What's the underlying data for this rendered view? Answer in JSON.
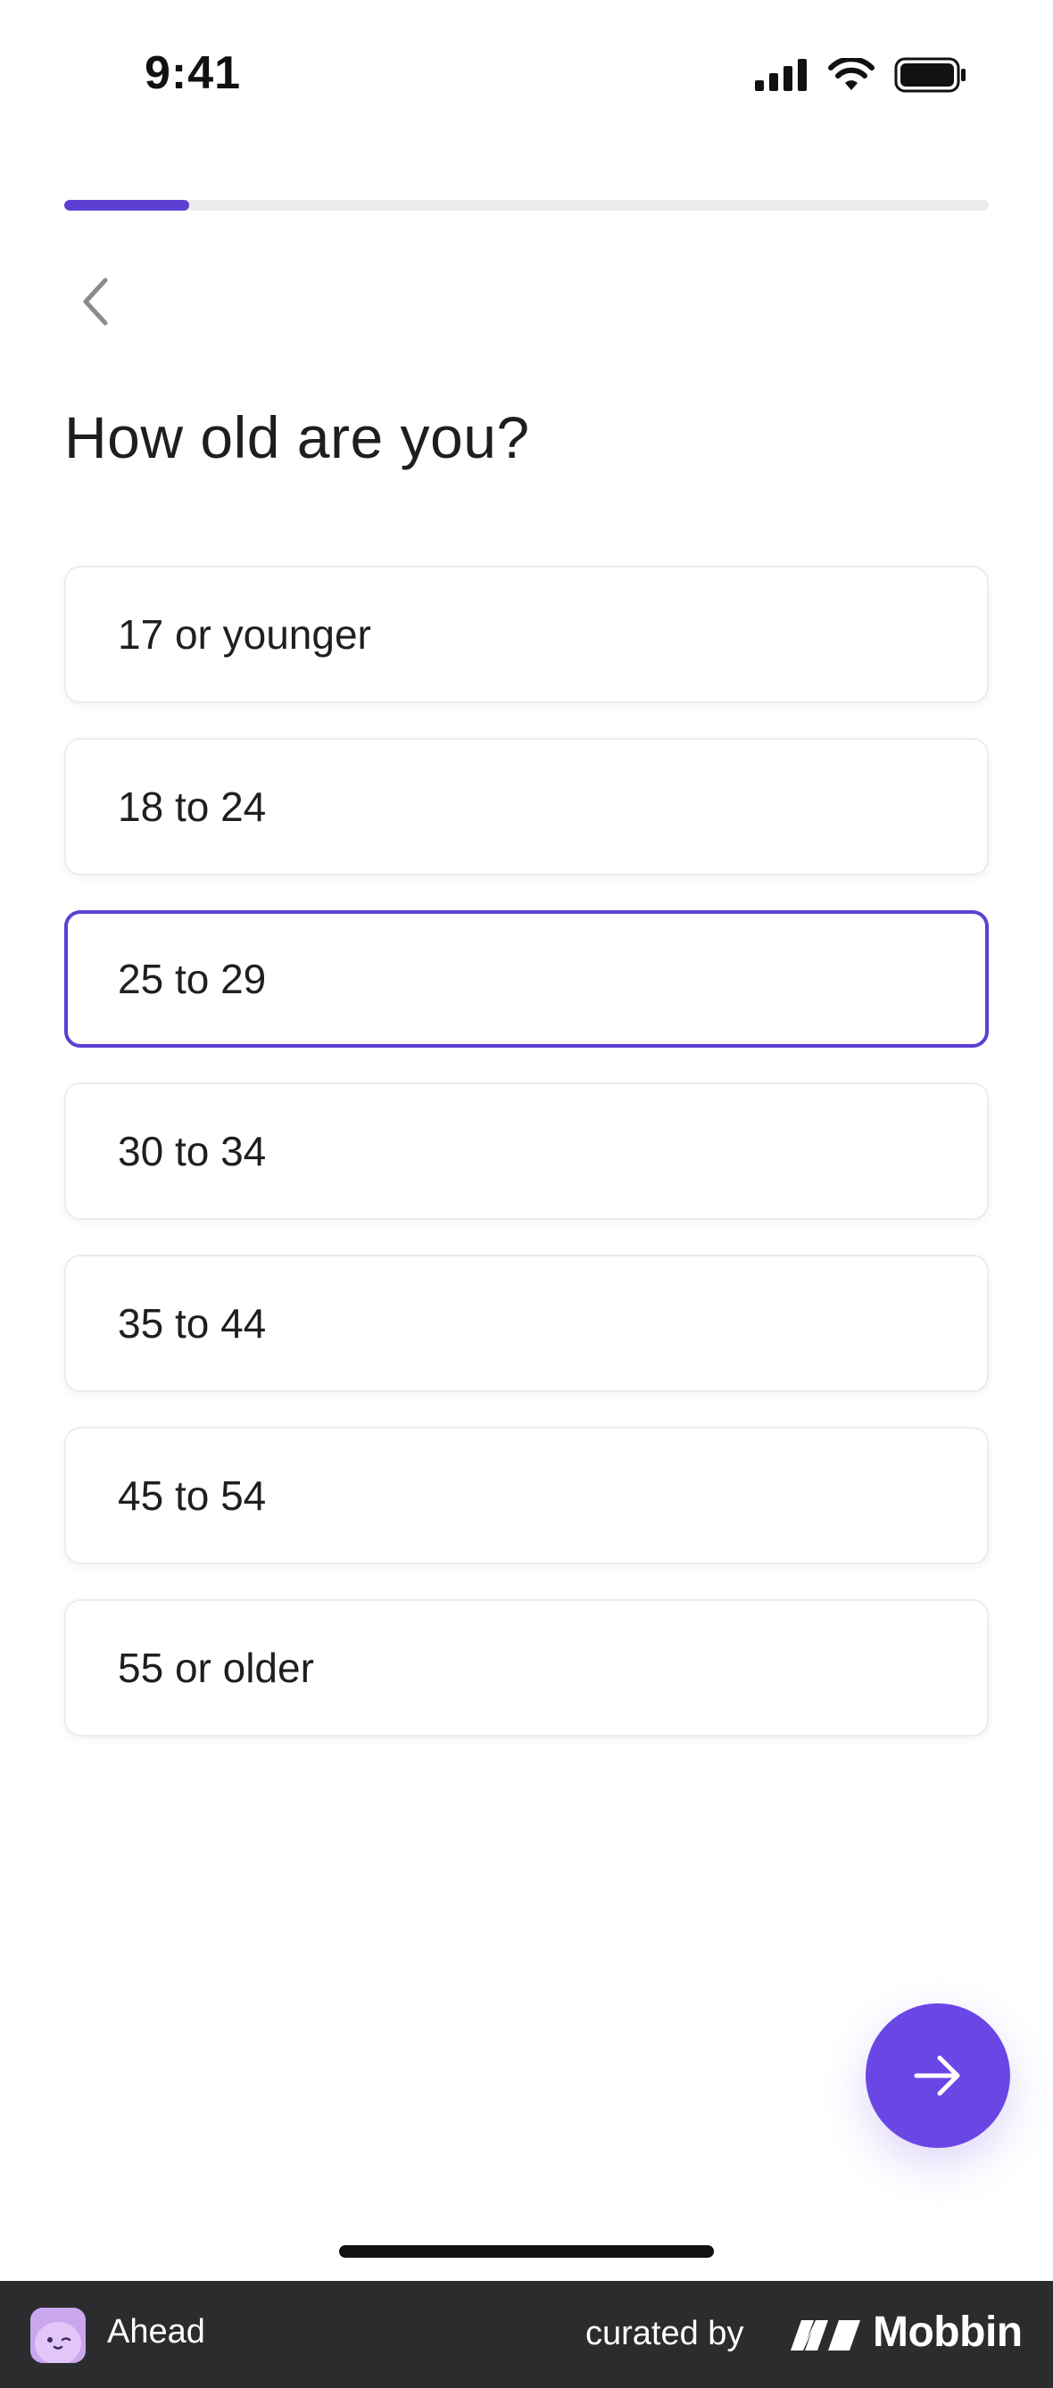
{
  "status_bar": {
    "time": "9:41",
    "icons": [
      "cellular-signal-icon",
      "wifi-icon",
      "battery-icon"
    ]
  },
  "progress": {
    "fraction": 0.135,
    "color": "#5d3fd3"
  },
  "nav": {
    "back_icon": "chevron-left-icon"
  },
  "question": {
    "title": "How old are you?"
  },
  "options": [
    {
      "label": "17 or younger",
      "selected": false
    },
    {
      "label": "18 to 24",
      "selected": false
    },
    {
      "label": "25 to 29",
      "selected": true
    },
    {
      "label": "30 to 34",
      "selected": false
    },
    {
      "label": "35 to 44",
      "selected": false
    },
    {
      "label": "45 to 54",
      "selected": false
    },
    {
      "label": "55 or older",
      "selected": false
    }
  ],
  "next_button": {
    "icon": "arrow-right-icon",
    "color": "#6a46e5"
  },
  "footer": {
    "app_name": "Ahead",
    "curated_by": "curated by",
    "brand": "Mobbin"
  },
  "colors": {
    "accent": "#5d3fd3",
    "footer_bg": "#2c2c2f"
  }
}
